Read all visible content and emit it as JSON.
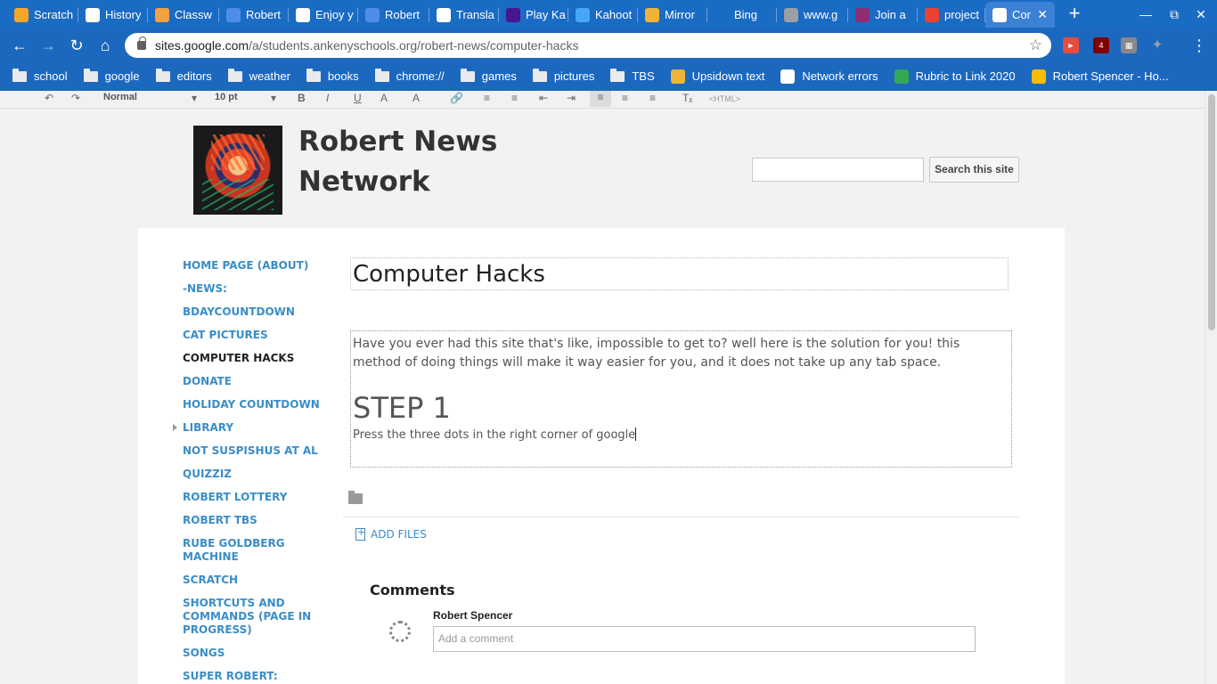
{
  "tabs": [
    {
      "label": "Scratch",
      "icon": "scratch-icon",
      "color": "#f7a628"
    },
    {
      "label": "History",
      "icon": "history-icon",
      "color": "#ffffff"
    },
    {
      "label": "Classw",
      "icon": "classroom-icon",
      "color": "#f4a142"
    },
    {
      "label": "Robert",
      "icon": "docs-icon",
      "color": "#4d8de8"
    },
    {
      "label": "Enjoy y",
      "icon": "globe-icon",
      "color": "#ffffff"
    },
    {
      "label": "Robert",
      "icon": "docs-icon",
      "color": "#4d8de8"
    },
    {
      "label": "Transla",
      "icon": "google-icon",
      "color": "#ffffff"
    },
    {
      "label": "Play Ka",
      "icon": "kahoot-icon",
      "color": "#46178f"
    },
    {
      "label": "Kahoot",
      "icon": "kahoot-k-icon",
      "color": "#46a6f7"
    },
    {
      "label": "Mirror",
      "icon": "magnifier-icon",
      "color": "#f0b33a"
    },
    {
      "label": "Bing",
      "icon": "blank-icon",
      "color": "#1a6bc4"
    },
    {
      "label": "www.g",
      "icon": "globe-icon",
      "color": "#9aa0a6"
    },
    {
      "label": "Join a",
      "icon": "quizizz-icon",
      "color": "#8e2d6f"
    },
    {
      "label": "project",
      "icon": "gmail-icon",
      "color": "#ea4335"
    },
    {
      "label": "Cor",
      "icon": "sites-icon",
      "color": "#ffffff",
      "active": true
    }
  ],
  "url": {
    "domain": "sites.google.com",
    "path": "/a/students.ankenyschools.org/robert-news/computer-hacks"
  },
  "bookmarks": [
    {
      "label": "school",
      "type": "folder"
    },
    {
      "label": "google",
      "type": "folder"
    },
    {
      "label": "editors",
      "type": "folder"
    },
    {
      "label": "weather",
      "type": "folder"
    },
    {
      "label": "books",
      "type": "folder"
    },
    {
      "label": "chrome://",
      "type": "folder"
    },
    {
      "label": "games",
      "type": "folder"
    },
    {
      "label": "pictures",
      "type": "folder"
    },
    {
      "label": "TBS",
      "type": "folder"
    },
    {
      "label": "Upsidown text",
      "type": "link",
      "color": "#f0b33a"
    },
    {
      "label": "Network errors",
      "type": "link",
      "color": "#ffffff"
    },
    {
      "label": "Rubric to Link 2020",
      "type": "link",
      "color": "#34a853"
    },
    {
      "label": "Robert Spencer - Ho...",
      "type": "link",
      "color": "#fbbc04"
    }
  ],
  "editor_toolbar": {
    "style": "Normal",
    "size": "10 pt",
    "html_label": "<HTML>"
  },
  "site": {
    "title": "Robert News Network",
    "search_button": "Search this site"
  },
  "nav": [
    "HOME PAGE (ABOUT)",
    "-NEWS:",
    "BDAYCOUNTDOWN",
    "CAT PICTURES",
    "COMPUTER HACKS",
    "DONATE",
    "HOLIDAY COUNTDOWN",
    "LIBRARY",
    "NOT SUSPISHUS AT AL",
    "QUIZZIZ",
    "ROBERT LOTTERY",
    "ROBERT TBS",
    "RUBE GOLDBERG MACHINE",
    "SCRATCH",
    "SHORTCUTS AND COMMANDS (PAGE IN PROGRESS)",
    "SONGS",
    "SUPER ROBERT:"
  ],
  "current_nav": "COMPUTER HACKS",
  "page": {
    "title": "Computer Hacks",
    "intro": "Have you ever had this site that's like, impossible to get to? well here is the solution for you! this method of doing things will make it way easier for you, and it does not take up any tab space.",
    "step_heading": "STEP 1",
    "step_text": "Press the three dots in the right corner of google"
  },
  "attachments": {
    "add_label": "ADD FILES"
  },
  "comments": {
    "heading": "Comments",
    "author": "Robert Spencer",
    "placeholder": "Add a comment"
  },
  "extensions": {
    "ublock_badge": "4"
  }
}
